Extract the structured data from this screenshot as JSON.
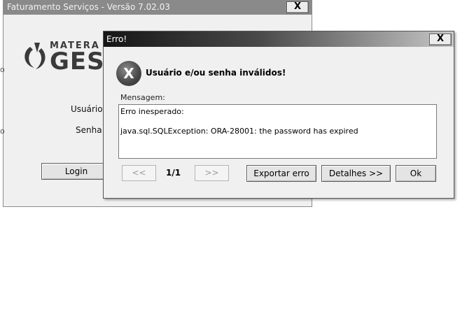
{
  "login_window": {
    "title": "Faturamento Serviços - Versão 7.02.03",
    "close_label": "X",
    "logo": {
      "line1": "MATERA",
      "line2": "GESTA"
    },
    "user_label": "Usuário",
    "password_label": "Senha",
    "login_button": "Login",
    "edge_fragments": [
      "o",
      "o"
    ]
  },
  "error_dialog": {
    "title": "Erro!",
    "close_label": "X",
    "icon_glyph": "X",
    "heading": "Usuário e/ou senha inválidos!",
    "message_label": "Mensagem:",
    "message_lines": [
      "Erro inesperado:",
      "java.sql.SQLException: ORA-28001: the password has expired"
    ],
    "prev_label": "<<",
    "page_indicator": "1/1",
    "next_label": ">>",
    "export_button": "Exportar erro",
    "details_button": "Detalhes >>",
    "ok_button": "Ok"
  }
}
